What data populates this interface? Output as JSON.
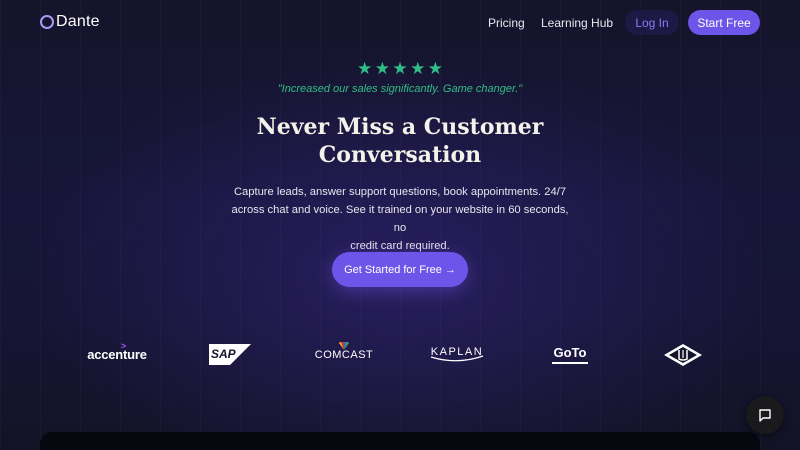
{
  "nav": {
    "brand": "Dante",
    "links": [
      "Pricing",
      "Learning Hub"
    ],
    "login_label": "Log In",
    "start_label": "Start Free"
  },
  "hero": {
    "rating_stars": 5,
    "quote": "\"Increased our sales significantly. Game changer.\"",
    "headline_line1": "Never Miss a Customer",
    "headline_line2": "Conversation",
    "subtext_line1": "Capture leads, answer support questions, book appointments. 24/7",
    "subtext_line2": "across chat and voice. See it trained on your website in 60 seconds, no",
    "subtext_line3": "credit card required.",
    "cta_label": "Get Started for Free →"
  },
  "logos": {
    "accenture": "accenture",
    "sap": "SAP",
    "comcast": "COMCAST",
    "kaplan": "KAPLAN",
    "goto": "GoTo"
  },
  "colors": {
    "accent": "#6c55e8",
    "star": "#2fbf86",
    "background": "#15142a"
  },
  "icons": {
    "logo": "dante-ring-icon",
    "star": "star-icon",
    "chat": "chat-bubble-icon"
  }
}
